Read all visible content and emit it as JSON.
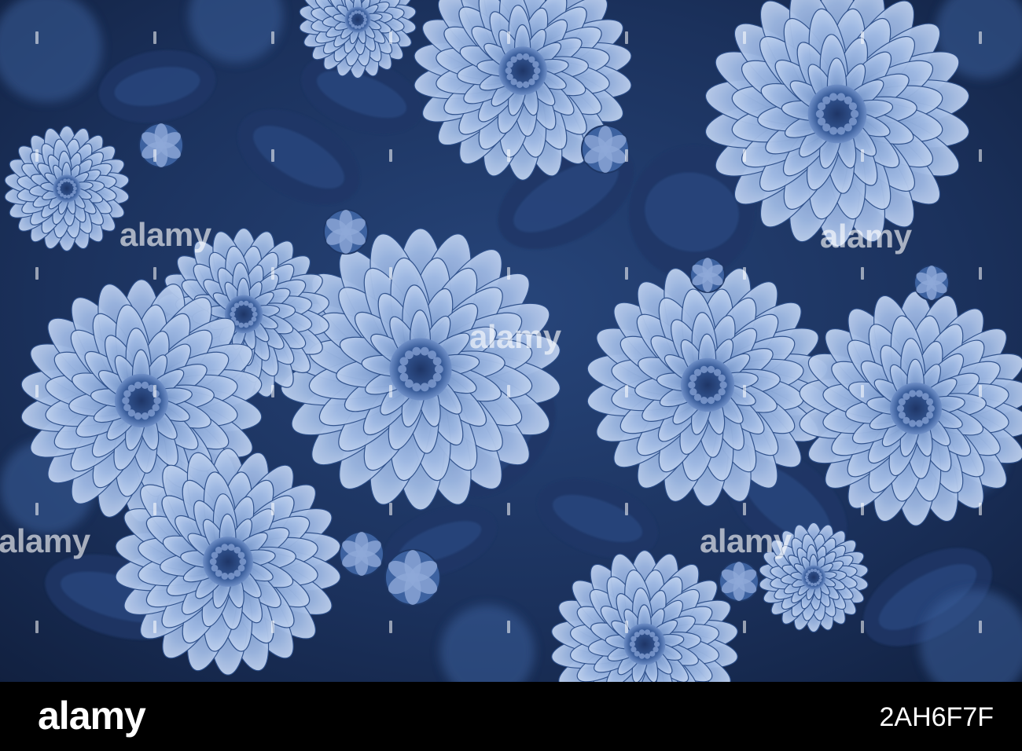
{
  "photo": {
    "subject": "blue toned chrysanthemum flowers",
    "colors": {
      "dark": "#14264a",
      "mid": "#3b5f9c",
      "light": "#b8cdef"
    }
  },
  "watermark": {
    "text": "alamy"
  },
  "footer": {
    "logo": "alamy",
    "image_id": "2AH6F7F"
  }
}
